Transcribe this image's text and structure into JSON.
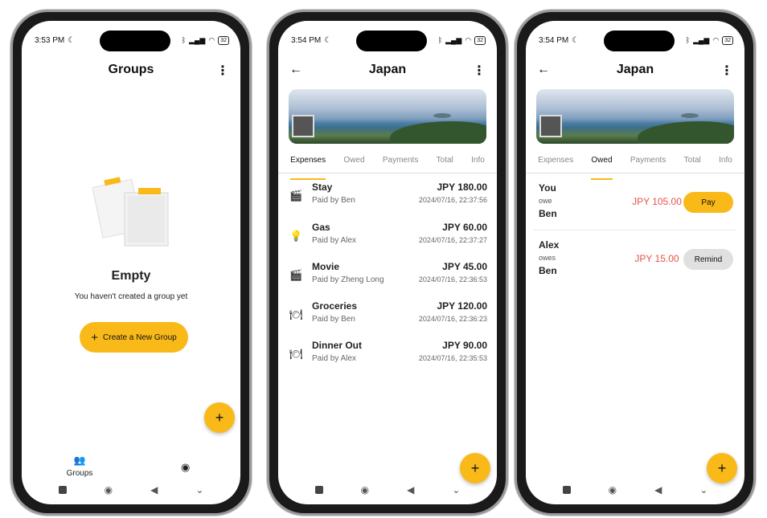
{
  "screen1": {
    "status_time": "3:53 PM",
    "status_battery": "32",
    "title": "Groups",
    "empty_title": "Empty",
    "empty_subtitle": "You haven't created a group yet",
    "create_button": "Create a New Group",
    "nav_groups": "Groups"
  },
  "screen2": {
    "status_time": "3:54 PM",
    "status_battery": "32",
    "title": "Japan",
    "tabs": [
      "Expenses",
      "Owed",
      "Payments",
      "Total",
      "Info"
    ],
    "expenses": [
      {
        "name": "Stay",
        "paid_by": "Paid by Ben",
        "amount": "JPY 180.00",
        "date": "2024/07/16, 22:37:56",
        "icon": "clapperboard-icon"
      },
      {
        "name": "Gas",
        "paid_by": "Paid by Alex",
        "amount": "JPY 60.00",
        "date": "2024/07/16, 22:37:27",
        "icon": "lightbulb-icon"
      },
      {
        "name": "Movie",
        "paid_by": "Paid by Zheng Long",
        "amount": "JPY 45.00",
        "date": "2024/07/16, 22:36:53",
        "icon": "clapperboard-icon"
      },
      {
        "name": "Groceries",
        "paid_by": "Paid by Ben",
        "amount": "JPY 120.00",
        "date": "2024/07/16, 22:36:23",
        "icon": "food-icon"
      },
      {
        "name": "Dinner Out",
        "paid_by": "Paid by Alex",
        "amount": "JPY 90.00",
        "date": "2024/07/16, 22:35:53",
        "icon": "food-icon"
      }
    ]
  },
  "screen3": {
    "status_time": "3:54 PM",
    "status_battery": "32",
    "title": "Japan",
    "tabs": [
      "Expenses",
      "Owed",
      "Payments",
      "Total",
      "Info"
    ],
    "owed": [
      {
        "who": "You",
        "verb": "owe",
        "to": "Ben",
        "amount": "JPY 105.00",
        "action": "Pay"
      },
      {
        "who": "Alex",
        "verb": "owes",
        "to": "Ben",
        "amount": "JPY 15.00",
        "action": "Remind"
      }
    ]
  },
  "colors": {
    "accent": "#f9b919",
    "owed_amount": "#e5534b"
  }
}
